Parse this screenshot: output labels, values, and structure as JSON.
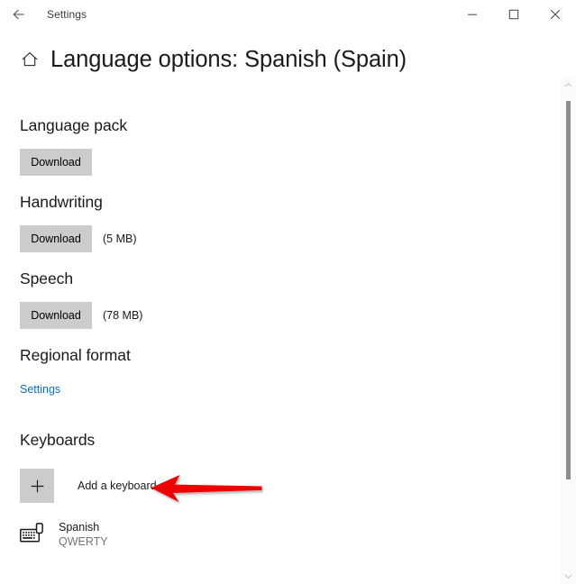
{
  "window": {
    "back_label": "back-arrow",
    "app_title": "Settings",
    "minimize_label": "Minimize",
    "maximize_label": "Maximize",
    "close_label": "Close"
  },
  "header": {
    "home_icon": "home-icon",
    "title": "Language options: Spanish (Spain)"
  },
  "sections": {
    "language_pack": {
      "heading": "Language pack",
      "download_label": "Download"
    },
    "handwriting": {
      "heading": "Handwriting",
      "download_label": "Download",
      "size": "(5 MB)"
    },
    "speech": {
      "heading": "Speech",
      "download_label": "Download",
      "size": "(78 MB)"
    },
    "regional_format": {
      "heading": "Regional format",
      "settings_link": "Settings"
    },
    "keyboards": {
      "heading": "Keyboards",
      "add_label": "Add a keyboard",
      "plus_icon": "plus-icon",
      "items": [
        {
          "icon": "keyboard-icon",
          "name": "Spanish",
          "layout": "QWERTY"
        }
      ]
    }
  },
  "scrollbar": {
    "up_icon": "chevron-up-icon",
    "down_icon": "chevron-down-icon",
    "thumb": "scrollbar-thumb"
  },
  "annotation": {
    "arrow": "red-pointer-arrow",
    "color": "#ee0000",
    "points_to": "Add a keyboard"
  },
  "colors": {
    "button_face": "#cccccc",
    "link_blue": "#0a6dc2",
    "text_primary": "#1a1a1a",
    "text_secondary": "#767676",
    "background": "#ffffff",
    "annotation_red": "#ee0000"
  }
}
